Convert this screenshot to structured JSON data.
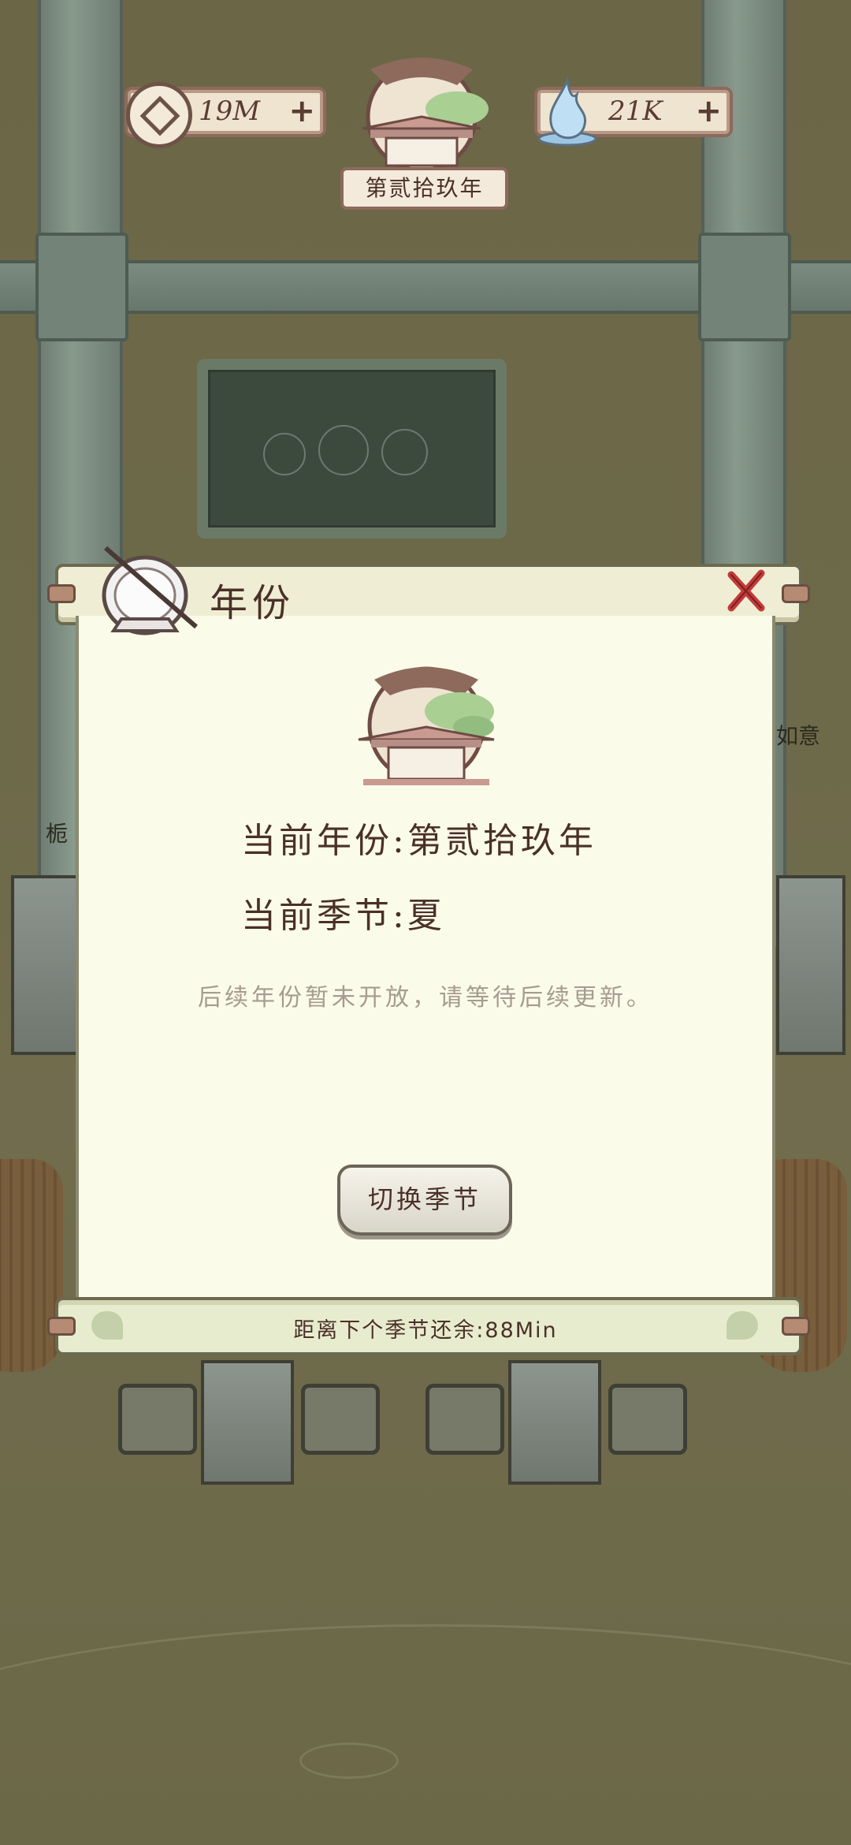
{
  "hud": {
    "coins": "19M",
    "water": "21K",
    "year_badge": "第贰拾玖年",
    "plus_symbol": "+"
  },
  "background": {
    "side_label_right": "如意",
    "side_label_left": "栀"
  },
  "modal": {
    "title": "年份",
    "current_year_label": "当前年份:",
    "current_year_value": "第贰拾玖年",
    "current_season_label": "当前季节:",
    "current_season_value": "夏",
    "note": "后续年份暂未开放，请等待后续更新。",
    "switch_button": "切换季节",
    "countdown": "距离下个季节还余:88Min"
  },
  "colors": {
    "panel": "#fbfbe9",
    "text": "#4a3028",
    "close_red": "#c23a3a",
    "dim_background": "#6d6a4a"
  },
  "icons": [
    "coin-icon",
    "water-drop-icon",
    "pavilion-emblem-icon",
    "sundial-icon",
    "close-icon",
    "ginkgo-leaf-icon"
  ]
}
